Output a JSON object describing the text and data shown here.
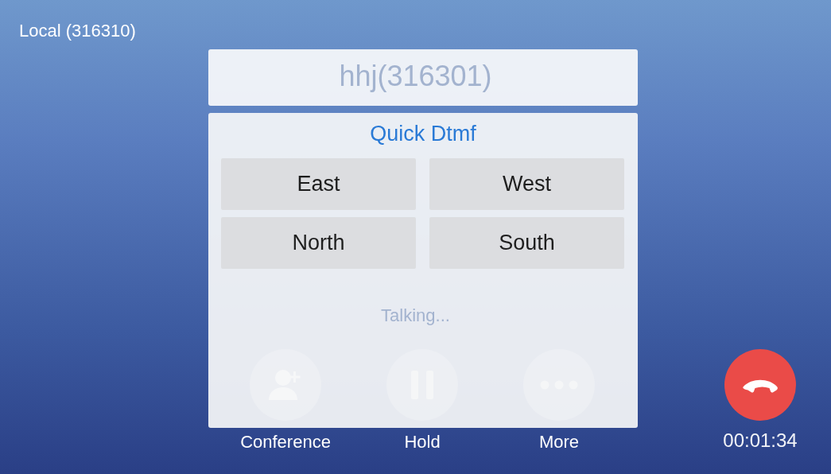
{
  "local_line": "Local (316310)",
  "call": {
    "remote_name": "hhj(316301)",
    "status": "Talking...",
    "actions": [
      {
        "kind": "conference",
        "label": "Conference"
      },
      {
        "kind": "hold",
        "label": "Hold"
      },
      {
        "kind": "more",
        "label": "More"
      }
    ],
    "timer": "00:01:34"
  },
  "dtmf_dialog": {
    "title": "Quick Dtmf",
    "buttons": [
      "East",
      "West",
      "North",
      "South"
    ]
  }
}
